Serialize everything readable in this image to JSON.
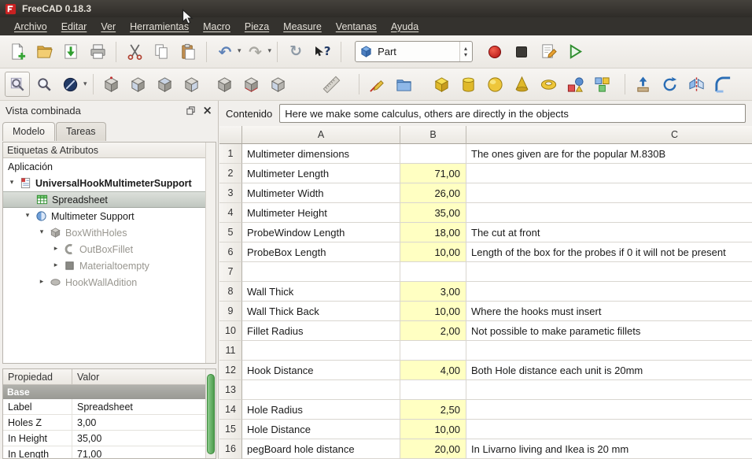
{
  "window": {
    "title": "FreeCAD 0.18.3"
  },
  "menubar": {
    "items": [
      "Archivo",
      "Editar",
      "Ver",
      "Herramientas",
      "Macro",
      "Pieza",
      "Measure",
      "Ventanas",
      "Ayuda"
    ]
  },
  "toolbar": {
    "workbench": "Part"
  },
  "icons": {
    "dropdown": "▾",
    "spin_up": "▴",
    "spin_down": "▾",
    "undo": "↶",
    "redo": "↷",
    "refresh": "↻",
    "question": "?",
    "close": "×",
    "exp_open": "▾",
    "exp_closed": "▸"
  },
  "combo_view": {
    "title": "Vista combinada",
    "tabs": [
      "Modelo",
      "Tareas"
    ],
    "tree_header": "Etiquetas & Atributos",
    "application_label": "Aplicación"
  },
  "tree": {
    "root": "UniversalHookMultimeterSupport",
    "spreadsheet": "Spreadsheet",
    "multimeter_support": "Multimeter Support",
    "box_with_holes": "BoxWithHoles",
    "out_box_fillet": "OutBoxFillet",
    "material_to_empty": "Materialtoempty",
    "hook_wall_adition": "HookWallAdition"
  },
  "properties": {
    "headers": [
      "Propiedad",
      "Valor"
    ],
    "group": "Base",
    "rows": [
      {
        "name": "Label",
        "value": "Spreadsheet"
      },
      {
        "name": "Holes Z",
        "value": "3,00"
      },
      {
        "name": "In Height",
        "value": "35,00"
      },
      {
        "name": "In Length",
        "value": "71,00"
      }
    ]
  },
  "content_bar": {
    "label": "Contenido",
    "value": "Here we make some calculus, others are directly in the objects"
  },
  "spreadsheet": {
    "col_headers": [
      "A",
      "B",
      "C"
    ],
    "rows": [
      {
        "n": "1",
        "a": "Multimeter dimensions",
        "b": "",
        "c": "The ones given are for the popular M.830B"
      },
      {
        "n": "2",
        "a": "Multimeter Length",
        "b": "71,00",
        "c": ""
      },
      {
        "n": "3",
        "a": "Multimeter Width",
        "b": "26,00",
        "c": ""
      },
      {
        "n": "4",
        "a": "Multimeter Height",
        "b": "35,00",
        "c": ""
      },
      {
        "n": "5",
        "a": "ProbeWindow Length",
        "b": "18,00",
        "c": "The cut at front"
      },
      {
        "n": "6",
        "a": "ProbeBox Length",
        "b": "10,00",
        "c": "Length of the box for the probes if 0 it will not be present"
      },
      {
        "n": "7",
        "a": "",
        "b": "",
        "c": ""
      },
      {
        "n": "8",
        "a": "Wall Thick",
        "b": "3,00",
        "c": ""
      },
      {
        "n": "9",
        "a": "Wall Thick Back",
        "b": "10,00",
        "c": "Where the hooks must insert"
      },
      {
        "n": "10",
        "a": "Fillet Radius",
        "b": "2,00",
        "c": "Not possible to make parametic fillets"
      },
      {
        "n": "11",
        "a": "",
        "b": "",
        "c": ""
      },
      {
        "n": "12",
        "a": "Hook Distance",
        "b": "4,00",
        "c": "Both Hole distance each unit is 20mm"
      },
      {
        "n": "13",
        "a": "",
        "b": "",
        "c": ""
      },
      {
        "n": "14",
        "a": "Hole Radius",
        "b": "2,50",
        "c": ""
      },
      {
        "n": "15",
        "a": "Hole Distance",
        "b": "10,00",
        "c": ""
      },
      {
        "n": "16",
        "a": "pegBoard hole distance",
        "b": "20,00",
        "c": "In Livarno living and Ikea is 20 mm"
      }
    ]
  },
  "colors": {
    "alias_cell_yellow": "#ffffc2",
    "selection_gray": "#c1c7c0",
    "scrollbar_green": "#4d9c4d",
    "titlebar_dark": "#34322e",
    "record_red": "#b01010",
    "accent_blue": "#2a6db5"
  }
}
